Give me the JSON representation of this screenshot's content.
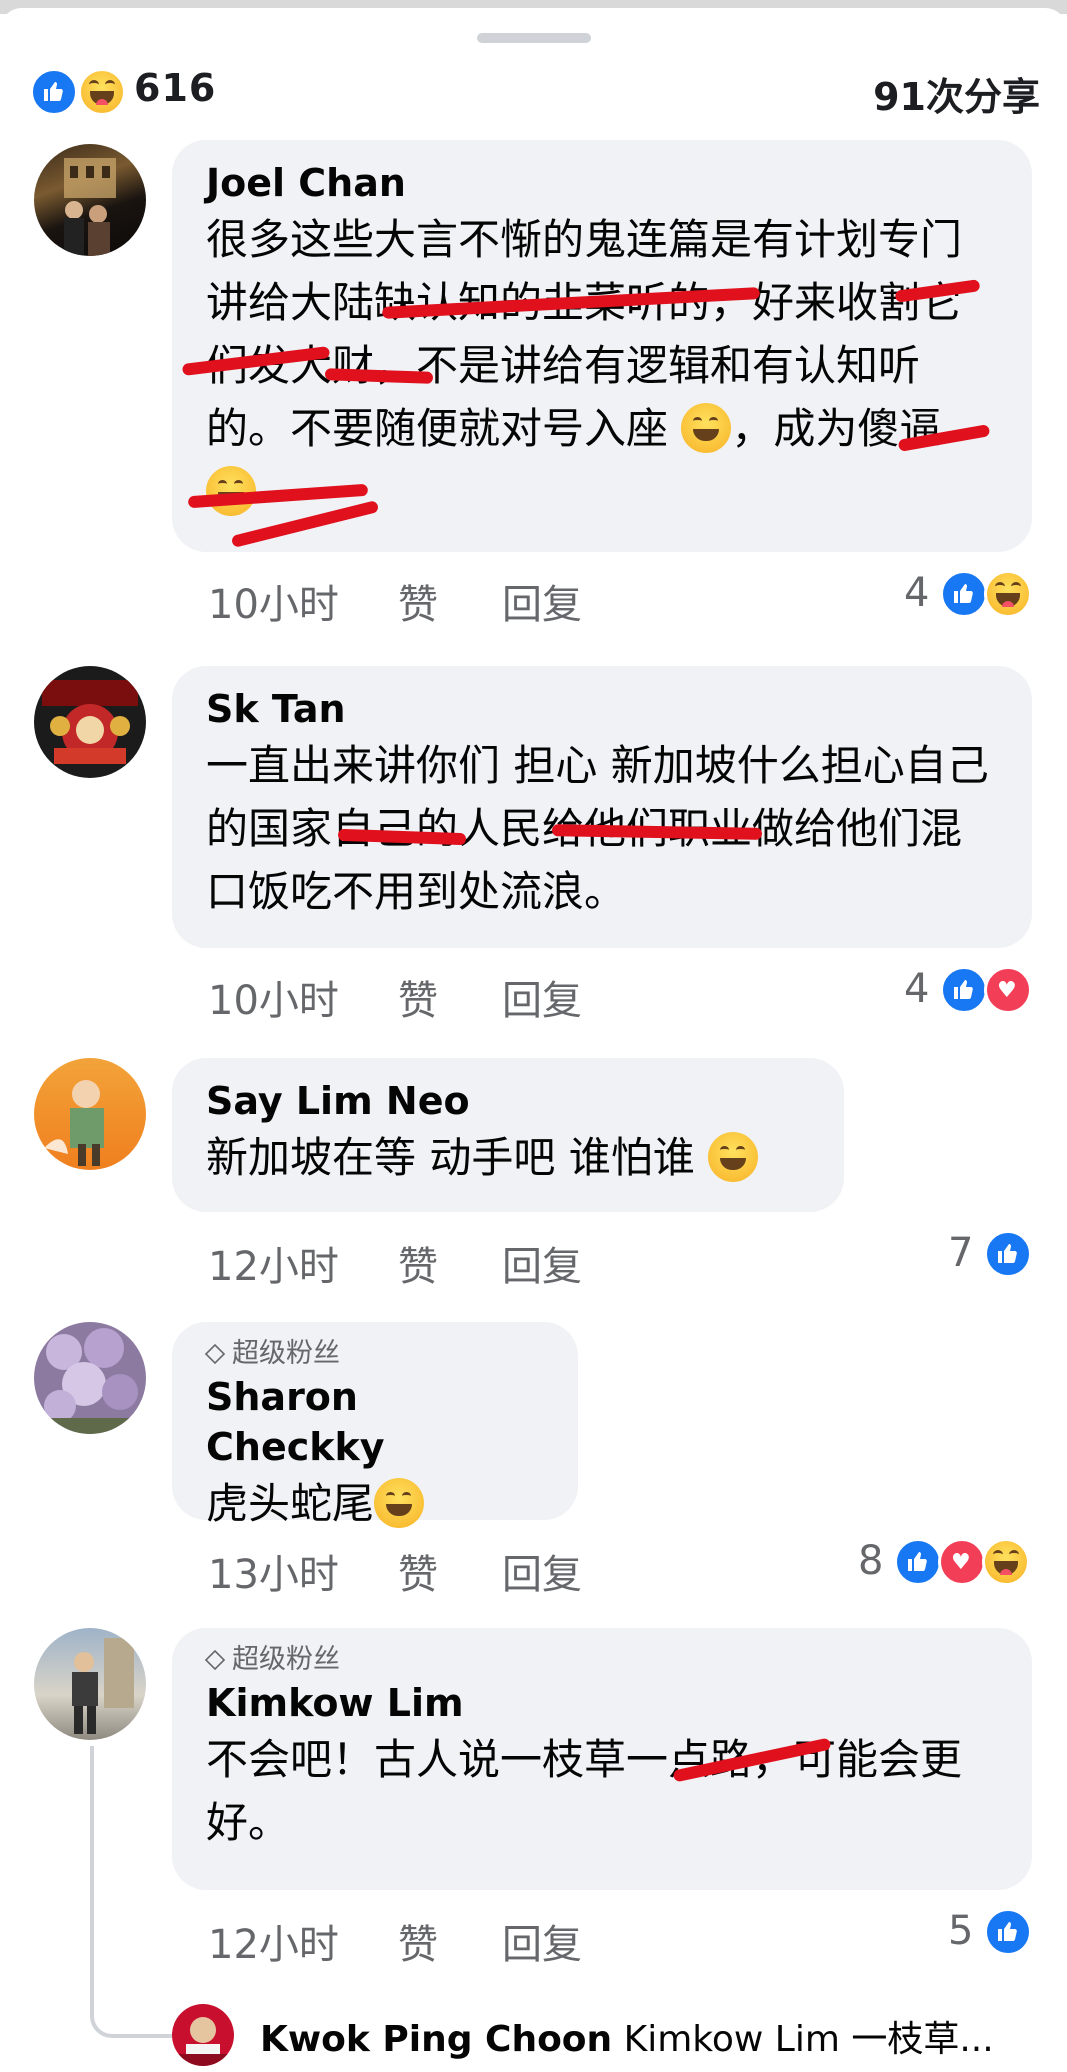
{
  "header": {
    "reaction_count": "616",
    "shares": "91次分享",
    "reactions": [
      "like-icon",
      "haha-icon"
    ]
  },
  "actions": {
    "like": "赞",
    "reply": "回复"
  },
  "comments": [
    {
      "author": "Joel Chan",
      "text": "很多这些大言不惭的鬼连篇是有计划专门讲给大陆缺认知的韭菜听的，好来收割它们发大财，不是讲给有逻辑和有认知听的。不要随便就对号入座",
      "text_tail": "，成为傻逼",
      "time": "10小时",
      "reaction_count": "4",
      "reactions": [
        "like-icon",
        "haha-icon"
      ]
    },
    {
      "author": "Sk Tan",
      "text": "一直出来讲你们 担心 新加坡什么担心自己的国家自己的人民给他们职业做给他们混口饭吃不用到处流浪。",
      "time": "10小时",
      "reaction_count": "4",
      "reactions": [
        "like-icon",
        "love-icon"
      ]
    },
    {
      "author": "Say Lim Neo",
      "text": "新加坡在等 动手吧 谁怕谁",
      "time": "12小时",
      "reaction_count": "7",
      "reactions": [
        "like-icon"
      ]
    },
    {
      "badge": "超级粉丝",
      "author": "Sharon Checkky",
      "text": "虎头蛇尾",
      "time": "13小时",
      "reaction_count": "8",
      "reactions": [
        "like-icon",
        "love-icon",
        "haha-icon"
      ]
    },
    {
      "badge": "超级粉丝",
      "author": "Kimkow Lim",
      "text": "不会吧！古人说一枝草一点路，可能会更好。",
      "time": "12小时",
      "reaction_count": "5",
      "reactions": [
        "like-icon"
      ]
    }
  ],
  "reply_preview": {
    "author": "Kwok Ping Choon",
    "text": "Kimkow Lim 一枝草..."
  },
  "colors": {
    "accent": "#1877f2",
    "bubble": "#f0f2f5",
    "muted": "#65676b",
    "scribble": "#e0101d"
  }
}
